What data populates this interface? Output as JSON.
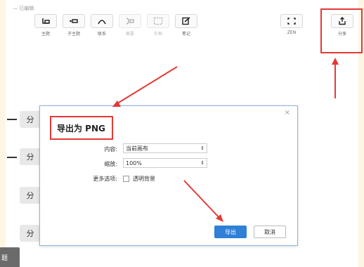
{
  "status_text": "— 已编辑",
  "toolbar": {
    "items": [
      {
        "label": "主题"
      },
      {
        "label": "子主题"
      },
      {
        "label": "联系"
      },
      {
        "label": "概要"
      },
      {
        "label": "外框"
      },
      {
        "label": "笔记"
      },
      {
        "label": "ZEN"
      },
      {
        "label": "分享"
      }
    ]
  },
  "canvas": {
    "nodes": [
      "分",
      "分",
      "分",
      "分"
    ],
    "side_tab": "题"
  },
  "dialog": {
    "title": "导出为 PNG",
    "close": "×",
    "content_label": "内容:",
    "content_value": "当前画布",
    "zoom_label": "缩放:",
    "zoom_value": "100%",
    "more_label": "更多选项:",
    "transparent_label": "透明背景",
    "export_button": "导出",
    "cancel_button": "取消"
  },
  "colors": {
    "highlight": "#e53935",
    "primary": "#2f80d6",
    "page_bg": "#fdf6e3"
  }
}
